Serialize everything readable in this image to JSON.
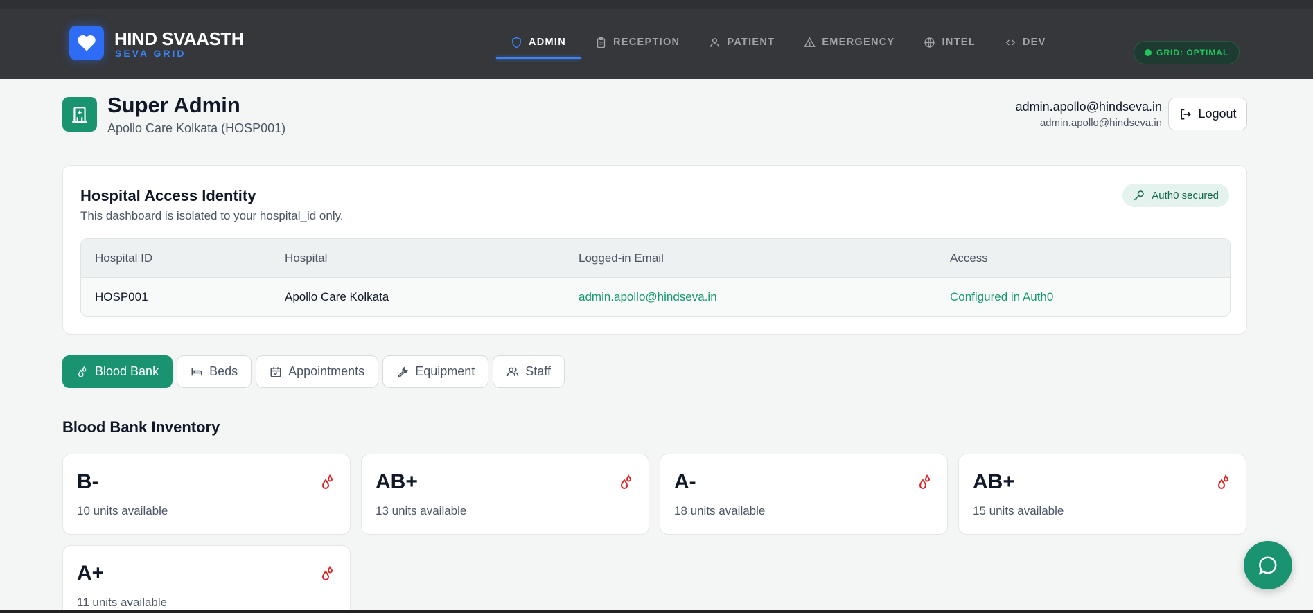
{
  "brand": {
    "title": "HIND SVAASTH",
    "subtitle": "SEVA GRID",
    "icon": "heart-icon"
  },
  "nav": {
    "items": [
      {
        "label": "ADMIN",
        "icon": "shield-icon",
        "active": true
      },
      {
        "label": "RECEPTION",
        "icon": "clipboard-icon",
        "active": false
      },
      {
        "label": "PATIENT",
        "icon": "user-icon",
        "active": false
      },
      {
        "label": "EMERGENCY",
        "icon": "warning-icon",
        "active": false
      },
      {
        "label": "INTEL",
        "icon": "globe-icon",
        "active": false
      },
      {
        "label": "DEV",
        "icon": "code-icon",
        "active": false
      }
    ],
    "status": "GRID: OPTIMAL"
  },
  "header": {
    "title": "Super Admin",
    "subtitle": "Apollo Care Kolkata (HOSP001)",
    "email": "admin.apollo@hindseva.in",
    "email_secondary": "admin.apollo@hindseva.in",
    "logout_label": "Logout"
  },
  "identity": {
    "title": "Hospital Access Identity",
    "subtitle": "This dashboard is isolated to your hospital_id only.",
    "badge": "Auth0 secured",
    "columns": [
      "Hospital ID",
      "Hospital",
      "Logged-in Email",
      "Access"
    ],
    "row": [
      "HOSP001",
      "Apollo Care Kolkata",
      "admin.apollo@hindseva.in",
      "Configured in Auth0"
    ]
  },
  "tabs": [
    {
      "label": "Blood Bank",
      "icon": "blood-drop-icon",
      "active": true
    },
    {
      "label": "Beds",
      "icon": "bed-icon",
      "active": false
    },
    {
      "label": "Appointments",
      "icon": "calendar-icon",
      "active": false
    },
    {
      "label": "Equipment",
      "icon": "wrench-icon",
      "active": false
    },
    {
      "label": "Staff",
      "icon": "users-icon",
      "active": false
    }
  ],
  "inventory": {
    "title": "Blood Bank Inventory",
    "items": [
      {
        "type": "B-",
        "units": "10 units available"
      },
      {
        "type": "AB+",
        "units": "13 units available"
      },
      {
        "type": "A-",
        "units": "18 units available"
      },
      {
        "type": "AB+",
        "units": "15 units available"
      },
      {
        "type": "A+",
        "units": "11 units available"
      }
    ]
  },
  "colors": {
    "accent": "#1a9470",
    "brand_blue": "#2f6cf6",
    "blood_red": "#dc2626",
    "nav_bg": "#35373a"
  }
}
